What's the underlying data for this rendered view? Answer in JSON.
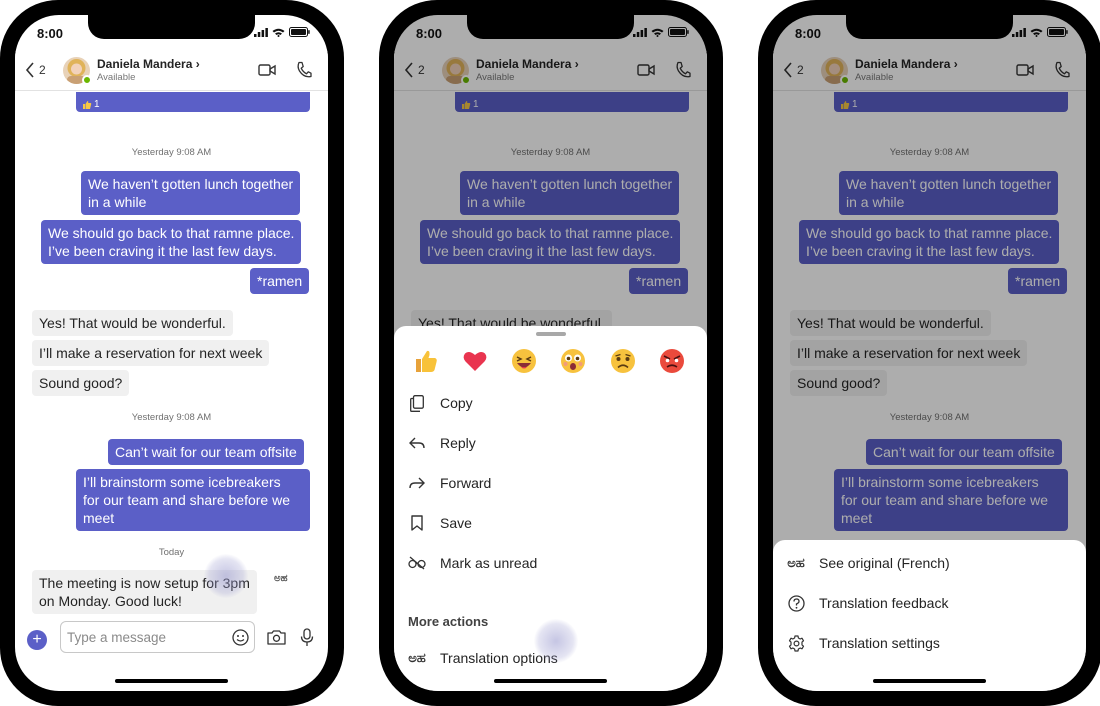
{
  "status_bar": {
    "time": "8:00"
  },
  "header": {
    "back_count": "2",
    "contact_name": "Daniela Mandera",
    "chevron": "›",
    "contact_status": "Available"
  },
  "reaction": {
    "count": "1"
  },
  "timestamps": {
    "first": "Yesterday 9:08 AM",
    "second": "Yesterday 9:08 AM",
    "today": "Today"
  },
  "messages": {
    "m1_l1": "We haven’t gotten lunch together",
    "m1_l2": "in a while",
    "m2_l1": "We should go back to that ramne place.",
    "m2_l2": "I’ve been craving it the last few days.",
    "m3": "*ramen",
    "m4": "Yes! That would be wonderful.",
    "m5": "I’ll make a reservation for next week",
    "m6": "Sound good?",
    "m7": "Can’t wait for our team offsite",
    "m8_l1": "I’ll brainstorm some icebreakers",
    "m8_l2": "for our team and share before we",
    "m8_l3": "meet",
    "m9_l1": "The meeting is now setup for 3pm",
    "m9_l2": "on Monday. Good luck!"
  },
  "translate_glyph": "ಅಹ",
  "compose": {
    "placeholder": "Type a message"
  },
  "action_sheet": {
    "emojis": [
      "thumbs-up",
      "heart",
      "laughing",
      "surprised",
      "sad",
      "angry"
    ],
    "items": [
      {
        "label": "Copy",
        "icon": "copy-icon"
      },
      {
        "label": "Reply",
        "icon": "reply-icon"
      },
      {
        "label": "Forward",
        "icon": "forward-icon"
      },
      {
        "label": "Save",
        "icon": "bookmark-icon"
      },
      {
        "label": "Mark as unread",
        "icon": "mark-unread-icon"
      }
    ],
    "more_actions_title": "More actions",
    "translation_options": "Translation options"
  },
  "translation_sheet": {
    "items": [
      {
        "label": "See original (French)",
        "icon": "translate-icon"
      },
      {
        "label": "Translation feedback",
        "icon": "help-circle-icon"
      },
      {
        "label": "Translation settings",
        "icon": "gear-icon"
      }
    ]
  },
  "colors": {
    "accent": "#5b5fc7",
    "incoming_bubble": "#f0f0f0",
    "presence": "#6bb700"
  }
}
